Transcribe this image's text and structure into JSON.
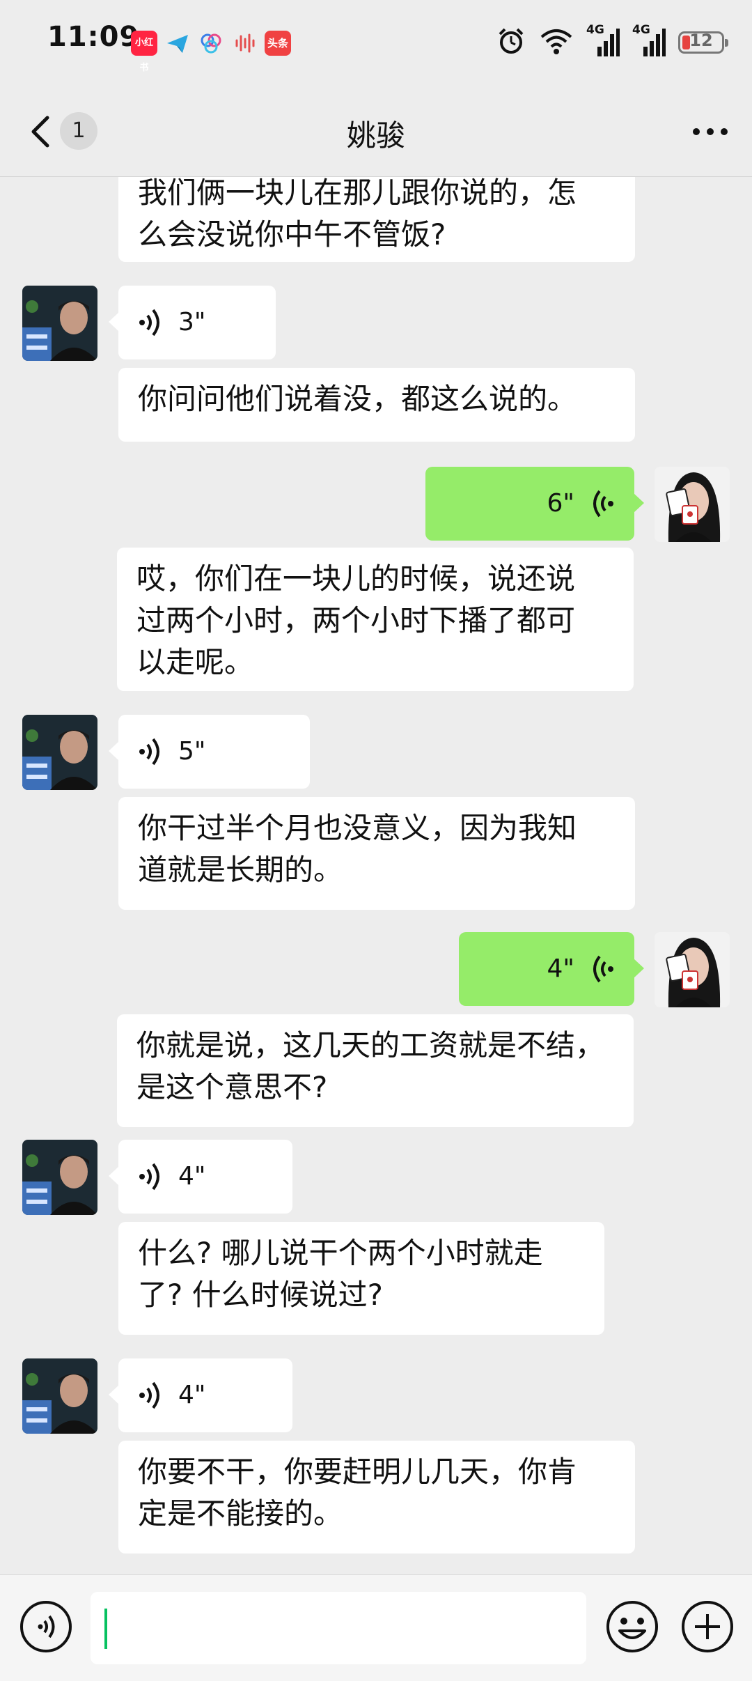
{
  "status_bar": {
    "time": "11:09",
    "notif_apps": [
      "小红书",
      "头条"
    ],
    "network_1": "4G",
    "network_2": "4G",
    "battery": "12"
  },
  "nav": {
    "unread_count": "1",
    "title": "姚骏"
  },
  "messages": [
    {
      "from": "contact",
      "kind": "text",
      "text_lines": [
        "我们俩一块儿在那儿跟你说的，怎",
        "么会没说你中午不管饭?"
      ]
    },
    {
      "from": "contact",
      "kind": "voice",
      "duration": "3\""
    },
    {
      "from": "contact",
      "kind": "text",
      "text_lines": [
        "你问问他们说着没，都这么说的。"
      ]
    },
    {
      "from": "me",
      "kind": "voice",
      "duration": "6\""
    },
    {
      "from": "me",
      "kind": "text",
      "text_lines": [
        "哎，你们在一块儿的时候，说还说",
        "过两个小时，两个小时下播了都可",
        "以走呢。"
      ]
    },
    {
      "from": "contact",
      "kind": "voice",
      "duration": "5\""
    },
    {
      "from": "contact",
      "kind": "text",
      "text_lines": [
        "你干过半个月也没意义，因为我知",
        "道就是长期的。"
      ]
    },
    {
      "from": "me",
      "kind": "voice",
      "duration": "4\""
    },
    {
      "from": "me",
      "kind": "text",
      "text_lines": [
        "你就是说，这几天的工资就是不结，",
        "是这个意思不?"
      ]
    },
    {
      "from": "contact",
      "kind": "voice",
      "duration": "4\""
    },
    {
      "from": "contact",
      "kind": "text",
      "text_lines": [
        "什么? 哪儿说干个两个小时就走",
        "了? 什么时候说过?"
      ]
    },
    {
      "from": "contact",
      "kind": "voice",
      "duration": "4\""
    },
    {
      "from": "contact",
      "kind": "text",
      "text_lines": [
        "你要不干，你要赶明儿几天，你肯",
        "定是不能接的。"
      ]
    }
  ],
  "input_bar": {
    "value": ""
  },
  "colors": {
    "background": "#ededed",
    "my_bubble": "#95ec69",
    "their_bubble": "#ffffff",
    "caret": "#07c160"
  }
}
